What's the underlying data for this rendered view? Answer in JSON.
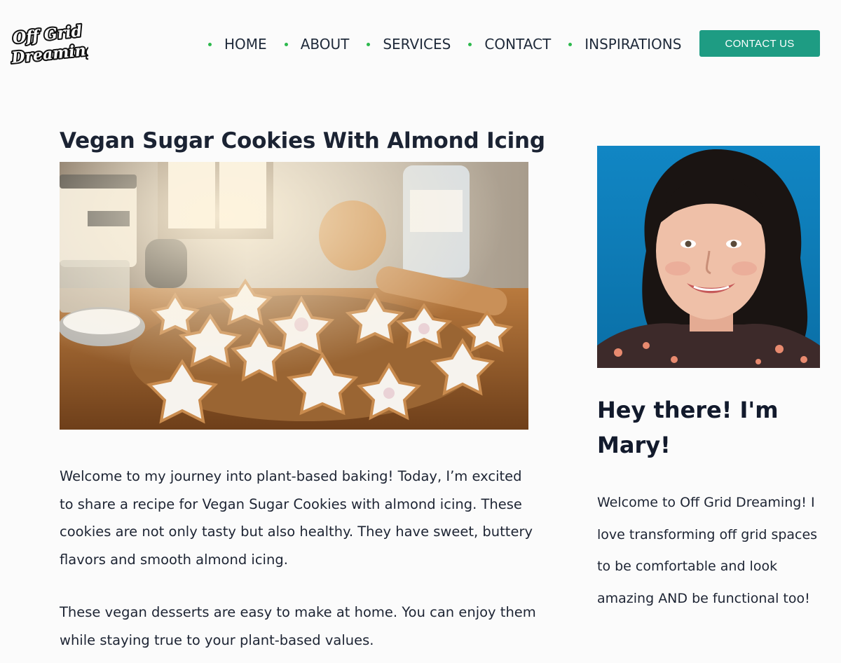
{
  "header": {
    "logo_text": [
      "Off Grid",
      "Dreaming"
    ],
    "nav": [
      {
        "label": "HOME"
      },
      {
        "label": "ABOUT"
      },
      {
        "label": "SERVICES"
      },
      {
        "label": "CONTACT"
      },
      {
        "label": "INSPIRATIONS"
      }
    ],
    "cta_label": "CONTACT US"
  },
  "post": {
    "title": "Vegan Sugar Cookies With Almond Icing",
    "hero_image": "star-shaped vegan sugar cookies with white almond icing on a wooden board",
    "paragraphs": [
      "Welcome to my journey into plant-based baking! Today, I’m excited to share a recipe for Vegan Sugar Cookies with almond icing. These cookies are not only tasty but also healthy. They have sweet, buttery flavors and smooth almond icing.",
      "These vegan desserts are easy to make at home. You can enjoy them while staying true to your plant-based values."
    ]
  },
  "sidebar": {
    "portrait_image": "portrait of a smiling woman with dark curly hair on a blue background",
    "title": "Hey there! I'm Mary!",
    "intro": "Welcome to Off Grid Dreaming! I love transforming off grid spaces to be comfortable and look amazing AND be functional too!"
  },
  "colors": {
    "accent": "#1e9c83",
    "nav_dot": "#2db94d",
    "text": "#1d2433",
    "portrait_bg": "#0f84c0"
  }
}
